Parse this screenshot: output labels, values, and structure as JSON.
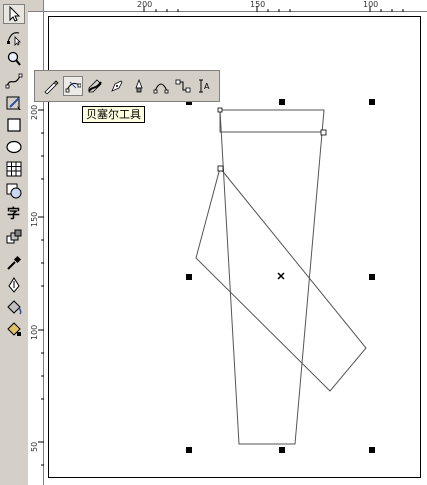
{
  "rulers": {
    "horizontal_labels": [
      "200",
      "150",
      "100"
    ],
    "vertical_labels": [
      "200",
      "150",
      "100",
      "50"
    ]
  },
  "toolbox": {
    "tools": [
      {
        "name": "pick-tool",
        "icon": "arrow-pointer-icon"
      },
      {
        "name": "shape-tool",
        "icon": "shape-node-icon"
      },
      {
        "name": "zoom-tool",
        "icon": "magnifier-icon"
      },
      {
        "name": "freehand-tool",
        "icon": "freehand-curve-icon"
      },
      {
        "name": "smart-fill-tool",
        "icon": "smart-drawing-icon"
      },
      {
        "name": "rectangle-tool",
        "icon": "rectangle-icon"
      },
      {
        "name": "ellipse-tool",
        "icon": "ellipse-icon"
      },
      {
        "name": "graph-paper-tool",
        "icon": "grid-icon"
      },
      {
        "name": "basic-shapes-tool",
        "icon": "basic-shapes-icon"
      },
      {
        "name": "text-tool",
        "icon": "text-icon"
      },
      {
        "name": "interactive-blend-tool",
        "icon": "blend-icon"
      },
      {
        "name": "eyedropper-tool",
        "icon": "eyedropper-icon"
      },
      {
        "name": "outline-tool",
        "icon": "pen-nib-icon"
      },
      {
        "name": "fill-tool",
        "icon": "paint-bucket-icon"
      },
      {
        "name": "interactive-fill-tool",
        "icon": "interactive-fill-icon"
      }
    ]
  },
  "flyout": {
    "tools": [
      {
        "name": "freehand-flyout",
        "icon": "freehand-icon"
      },
      {
        "name": "bezier-flyout",
        "icon": "bezier-icon"
      },
      {
        "name": "artistic-media-flyout",
        "icon": "artistic-media-icon"
      },
      {
        "name": "pen-flyout",
        "icon": "pen-icon"
      },
      {
        "name": "polyline-flyout",
        "icon": "polyline-icon"
      },
      {
        "name": "three-point-curve-flyout",
        "icon": "three-point-curve-icon"
      },
      {
        "name": "interactive-connector-flyout",
        "icon": "connector-icon"
      },
      {
        "name": "dimension-flyout",
        "icon": "dimension-icon"
      }
    ],
    "tooltip": "贝塞尔工具"
  }
}
